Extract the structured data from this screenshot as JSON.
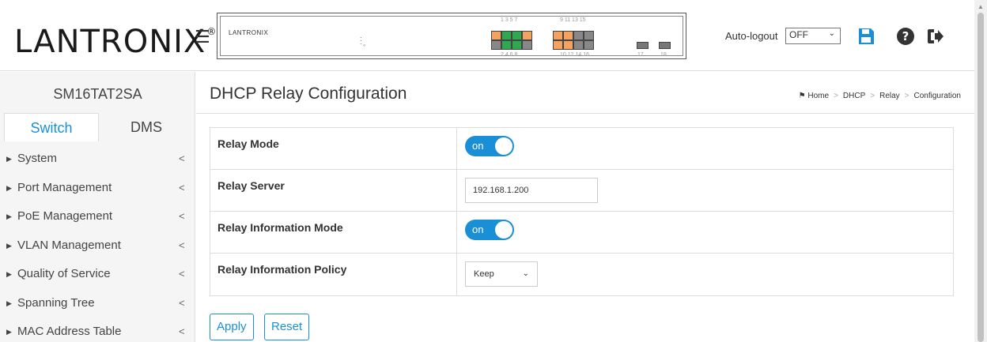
{
  "header": {
    "logo_text": "LANTRONIX",
    "logo_mark": "®",
    "menu_icon": "hamburger-icon",
    "panel": {
      "brand": "LANTRONIX",
      "top_port_numbers": "1 3 5 7",
      "top_port_numbers_2": "9 11 13 15",
      "bottom_port_numbers": "2 4 6 8",
      "bottom_port_numbers_2": "10 12 14 16",
      "sfp_numbers": [
        "17",
        "18"
      ]
    },
    "autologout_label": "Auto-logout",
    "autologout_value": "OFF",
    "icons": [
      "save-icon",
      "help-icon",
      "logout-icon"
    ]
  },
  "sidebar": {
    "device_name": "SM16TAT2SA",
    "tabs": [
      {
        "label": "Switch",
        "active": true
      },
      {
        "label": "DMS",
        "active": false
      }
    ],
    "items": [
      {
        "label": "System"
      },
      {
        "label": "Port Management"
      },
      {
        "label": "PoE Management"
      },
      {
        "label": "VLAN Management"
      },
      {
        "label": "Quality of Service"
      },
      {
        "label": "Spanning Tree"
      },
      {
        "label": "MAC Address Table"
      }
    ]
  },
  "main": {
    "title": "DHCP Relay Configuration",
    "breadcrumb": [
      "Home",
      "DHCP",
      "Relay",
      "Configuration"
    ],
    "rows": [
      {
        "label": "Relay Mode",
        "type": "toggle",
        "value": "on"
      },
      {
        "label": "Relay Server",
        "type": "input",
        "value": "192.168.1.200"
      },
      {
        "label": "Relay Information Mode",
        "type": "toggle",
        "value": "on"
      },
      {
        "label": "Relay Information Policy",
        "type": "select",
        "value": "Keep"
      }
    ],
    "buttons": {
      "apply": "Apply",
      "reset": "Reset"
    }
  },
  "colors": {
    "accent": "#1a8fd6",
    "logo_accent": "#e8432e",
    "port_green": "#2fa84f",
    "port_orange": "#f4a261",
    "port_gray": "#888888"
  }
}
